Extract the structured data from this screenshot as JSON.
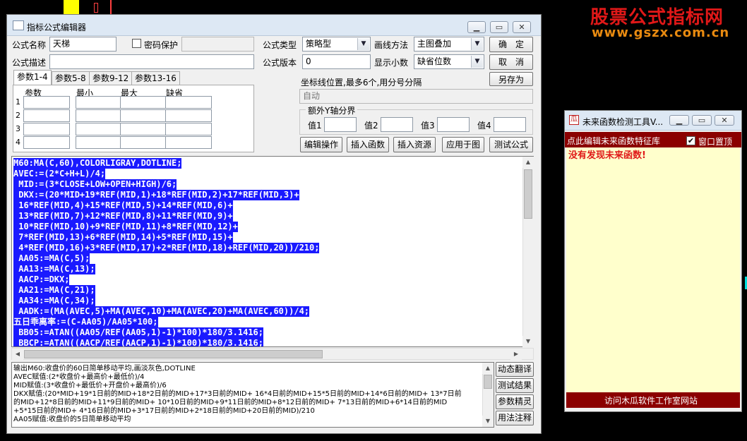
{
  "brand": {
    "title": "股票公式指标网",
    "url": "www.gszx.com.cn"
  },
  "editor": {
    "title": "指标公式编辑器",
    "labels": {
      "name": "公式名称",
      "pwd": "密码保护",
      "type": "公式类型",
      "draw": "画线方法",
      "desc": "公式描述",
      "version": "公式版本",
      "decimals": "显示小数"
    },
    "fields": {
      "name_value": "天梯",
      "type_value": "策略型",
      "draw_value": "主图叠加",
      "version_value": "0",
      "decimals_value": "缺省位数"
    },
    "buttons": {
      "ok": "确　定",
      "cancel": "取　消",
      "save_as": "另存为",
      "edit_ops": "编辑操作",
      "insert_func": "插入函数",
      "insert_res": "插入资源",
      "apply_chart": "应用于图",
      "test": "测试公式"
    },
    "tabs": [
      "参数1-4",
      "参数5-8",
      "参数9-12",
      "参数13-16"
    ],
    "param_headers": [
      "参数",
      "最小",
      "最大",
      "缺省"
    ],
    "param_rows": [
      "1",
      "2",
      "3",
      "4"
    ],
    "axis": {
      "label": "坐标线位置,最多6个,用分号分隔",
      "value": "自动",
      "group": "额外Y轴分界",
      "v1": "值1",
      "v2": "值2",
      "v3": "值3",
      "v4": "值4"
    },
    "code": [
      "M60:MA(C,60),COLORLIGRAY,DOTLINE;",
      "AVEC:=(2*C+H+L)/4;",
      " MID:=(3*CLOSE+LOW+OPEN+HIGH)/6;",
      " DKX:=(20*MID+19*REF(MID,1)+18*REF(MID,2)+17*REF(MID,3)+",
      " 16*REF(MID,4)+15*REF(MID,5)+14*REF(MID,6)+",
      " 13*REF(MID,7)+12*REF(MID,8)+11*REF(MID,9)+",
      " 10*REF(MID,10)+9*REF(MID,11)+8*REF(MID,12)+",
      " 7*REF(MID,13)+6*REF(MID,14)+5*REF(MID,15)+",
      " 4*REF(MID,16)+3*REF(MID,17)+2*REF(MID,18)+REF(MID,20))/210;",
      " AA05:=MA(C,5);",
      " AA13:=MA(C,13);",
      " AACP:=DKX;",
      " AA21:=MA(C,21);",
      " AA34:=MA(C,34);",
      " AADK:=(MA(AVEC,5)+MA(AVEC,10)+MA(AVEC,20)+MA(AVEC,60))/4;",
      "五日乖离率:=(C-AA05)/AA05*100;",
      " BB05:=ATAN((AA05/REF(AA05,1)-1)*100)*180/3.1416;",
      " BBCP:=ATAN((AACP/REF(AACP,1)-1)*100)*180/3.1416;"
    ],
    "output": [
      "输出M60:收盘价的60日简单移动平均,画淡灰色,DOTLINE",
      "AVEC赋值:(2*收盘价+最高价+最低价)/4",
      "MID赋值:(3*收盘价+最低价+开盘价+最高价)/6",
      "DKX赋值:(20*MID+19*1日前的MID+18*2日前的MID+17*3日前的MID+ 16*4日前的MID+15*5日前的MID+14*6日前的MID+ 13*7日前",
      "的MID+12*8日前的MID+11*9日前的MID+ 10*10日前的MID+9*11日前的MID+8*12日前的MID+ 7*13日前的MID+6*14日前的MID",
      "+5*15日前的MID+ 4*16日前的MID+3*17日前的MID+2*18日前的MID+20日前的MID)/210",
      "AA05赋值:收盘价的5日简单移动平均"
    ],
    "side_buttons": [
      "动态翻译",
      "测试结果",
      "参数精灵",
      "用法注释"
    ]
  },
  "future_tool": {
    "title": "未来函数检测工具V...",
    "header_text": "点此编辑未来函数特征库",
    "topmost_label": "窗口置顶",
    "result": "没有发现未来函数!",
    "footer": "访问木瓜软件工作室网站"
  },
  "colors": {
    "code_highlight": "#1a1aff",
    "brand_red": "#e01818",
    "brand_orange": "#e88a10",
    "tool_header": "#8b0000",
    "tool_body": "#ffffcc"
  }
}
